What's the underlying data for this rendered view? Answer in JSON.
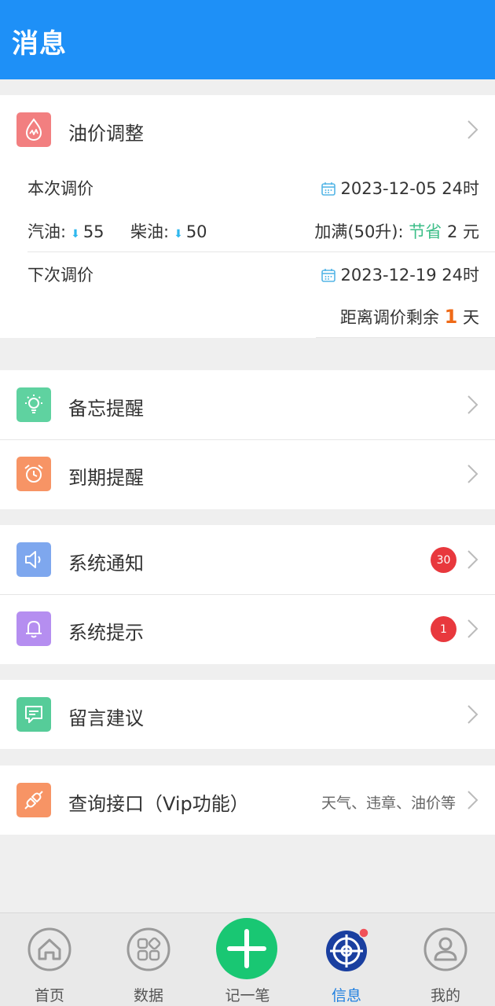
{
  "header": {
    "title": "消息"
  },
  "oil": {
    "title": "油价调整",
    "current_label": "本次调价",
    "current_date": "2023-12-05 24时",
    "gasoline_label": "汽油:",
    "gasoline_value": "55",
    "diesel_label": "柴油:",
    "diesel_value": "50",
    "fill_label": "加满(50升):",
    "save_label": "节省",
    "save_value": "2 元",
    "next_label": "下次调价",
    "next_date": "2023-12-19 24时",
    "remain_prefix": "距离调价剩余",
    "remain_days": "1",
    "remain_suffix": "天"
  },
  "rows": {
    "memo": {
      "label": "备忘提醒"
    },
    "expiry": {
      "label": "到期提醒"
    },
    "system_notice": {
      "label": "系统通知",
      "badge": "30"
    },
    "system_tip": {
      "label": "系统提示",
      "badge": "1"
    },
    "feedback": {
      "label": "留言建议"
    },
    "api": {
      "label": "查询接口（Vip功能）",
      "hint": "天气、违章、油价等"
    }
  },
  "tabs": {
    "home": "首页",
    "data": "数据",
    "add": "记一笔",
    "messages": "信息",
    "mine": "我的"
  },
  "colors": {
    "header": "#1e90f7",
    "oil_icon": "#f27f80",
    "memo_icon": "#5fd2a0",
    "expiry_icon": "#f79465",
    "notice_icon": "#7ea7ee",
    "tip_icon": "#b58ef0",
    "feedback_icon": "#56cc99",
    "api_icon": "#f79465",
    "badge": "#e8383d",
    "add_button": "#19c773",
    "active_tab": "#1e7fe0"
  }
}
